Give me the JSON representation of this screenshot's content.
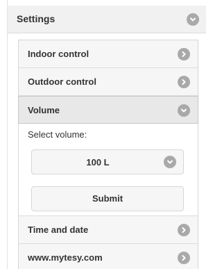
{
  "header": {
    "title": "Settings",
    "icon": "chevron-down-icon"
  },
  "menu": {
    "items": [
      {
        "label": "Indoor control",
        "icon": "chevron-right-icon"
      },
      {
        "label": "Outdoor control",
        "icon": "chevron-right-icon"
      },
      {
        "label": "Volume",
        "icon": "chevron-down-icon",
        "expanded": true
      },
      {
        "label": "Time and date",
        "icon": "chevron-right-icon"
      },
      {
        "label": "www.mytesy.com",
        "icon": "chevron-right-icon"
      }
    ]
  },
  "volume": {
    "prompt": "Select volume:",
    "selected": "100 L",
    "submit_label": "Submit"
  },
  "colors": {
    "icon_circle": "#a9a9a9",
    "row_background": "#f6f6f6",
    "header_background": "#f1f1f1"
  }
}
